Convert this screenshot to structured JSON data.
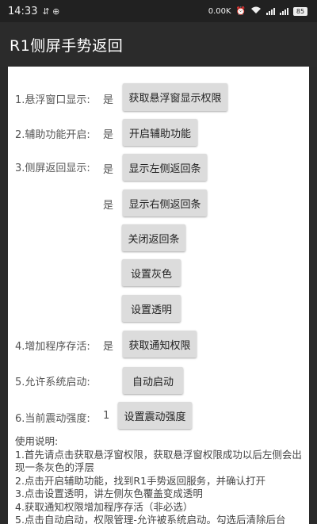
{
  "status_bar": {
    "time": "14:33",
    "left_glyphs": "⇵ ⊕",
    "speed": "0.00K",
    "battery": "85"
  },
  "app": {
    "title": "R1侧屏手势返回"
  },
  "rows": {
    "r1": {
      "label": "1.悬浮窗口显示:",
      "value": "是",
      "button": "获取悬浮窗显示权限"
    },
    "r2": {
      "label": "2.辅助功能开启:",
      "value": "是",
      "button": "开启辅助功能"
    },
    "r3": {
      "label": "3.侧屏返回显示:",
      "value": "是",
      "button": "显示左侧返回条"
    },
    "r3b": {
      "value": "是",
      "button": "显示右侧返回条"
    },
    "r3c": {
      "button": "关闭返回条"
    },
    "r3d": {
      "button": "设置灰色"
    },
    "r3e": {
      "button": "设置透明"
    },
    "r4": {
      "label": "4.增加程序存活:",
      "value": "是",
      "button": "获取通知权限"
    },
    "r5": {
      "label": "5.允许系统启动:",
      "button": "自动启动"
    },
    "r6": {
      "label": "6.当前震动强度:",
      "value": "1",
      "button": "设置震动强度"
    }
  },
  "instructions": {
    "title": "使用说明:",
    "line1": "1.首先请点击获取悬浮窗权限，获取悬浮窗权限成功以后左侧会出现一条灰色的浮层",
    "line2": " 2.点击开启辅助功能，找到R1手势返回服务，并确认打开",
    " line3": "",
    "line3": " 3.点击设置透明，讲左侧灰色覆盖变成透明",
    "line4": " 4.获取通知权限增加程序存活（非必选）",
    "line5": " 5.点击自动启动，权限管理-允许被系统启动。勾选后清除后台"
  }
}
